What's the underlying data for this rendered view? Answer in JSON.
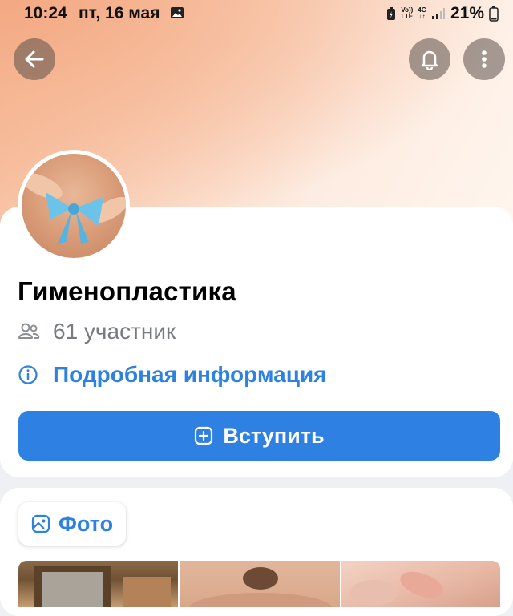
{
  "status_bar": {
    "time": "10:24",
    "date": "пт, 16 мая",
    "net_top": "Vo))",
    "net_bottom": "LTE",
    "gen_top": "4G",
    "gen_bottom": "↓↑",
    "battery": "21%"
  },
  "header": {
    "back_icon": "arrow-left-icon",
    "bell_icon": "bell-icon",
    "more_icon": "more-vertical-icon"
  },
  "group": {
    "title": "Гименопластика",
    "members": "61 участник",
    "info_link": "Подробная информация",
    "join_label": "Вступить"
  },
  "photos": {
    "tab_label": "Фото"
  },
  "colors": {
    "accent": "#2f80e3",
    "link": "#2d81e0",
    "muted": "#777b80"
  }
}
